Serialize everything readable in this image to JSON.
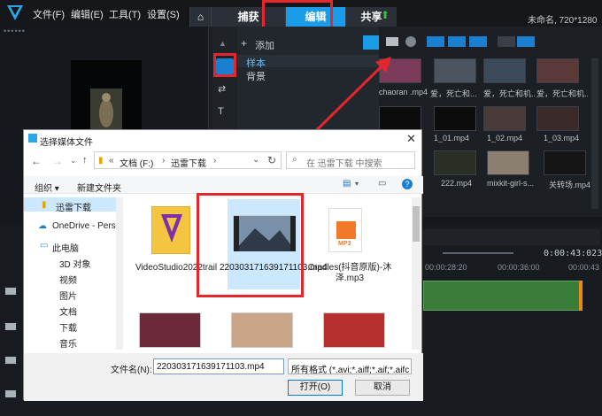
{
  "menu": [
    "文件(F)",
    "编辑(E)",
    "工具(T)",
    "设置(S)"
  ],
  "tabs": {
    "capture": "捕获",
    "edit": "编辑",
    "share": "共享"
  },
  "project_info": "未命名, 720*1280",
  "library": {
    "add_label": "添加",
    "tree": [
      "样本",
      "背景"
    ]
  },
  "library_thumbs": [
    "chaoran .mp4",
    "爱，死亡和...",
    "爱，死亡和机...",
    "爱，死亡和机...",
    "1_01.mp4",
    "1_02.mp4",
    "1_03.mp4",
    "222.mp4",
    "mixkit-girl-s...",
    "关转场.mp4"
  ],
  "timeline": {
    "timecode": "0:00:43:023",
    "ruler": [
      "00:00:28:20",
      "00:00:36:00",
      "00:00:43"
    ]
  },
  "dialog": {
    "title": "选择媒体文件",
    "path": [
      "文档 (F:)",
      "迅雷下载"
    ],
    "search_placeholder": "在 迅雷下载 中搜索",
    "organize": "组织 ▾",
    "new_folder": "新建文件夹",
    "nav": [
      "迅雷下载",
      "OneDrive - Perso",
      "此电脑",
      "3D 对象",
      "视频",
      "图片",
      "文档",
      "下载",
      "音乐"
    ],
    "files": [
      {
        "name": "VideoStudio2022trail",
        "type": "folder"
      },
      {
        "name": "220303171639171103.mp4",
        "type": "video"
      },
      {
        "name": "Cradles(抖音原版)-沐泽.mp3",
        "type": "audio"
      }
    ],
    "filename_label": "文件名(N):",
    "filename_value": "220303171639171103.mp4",
    "filetype_value": "所有格式 (*.avi;*.aiff;*.aif;*.aifc",
    "open": "打开(O)",
    "cancel": "取消",
    "mp3_badge": "MP3"
  }
}
